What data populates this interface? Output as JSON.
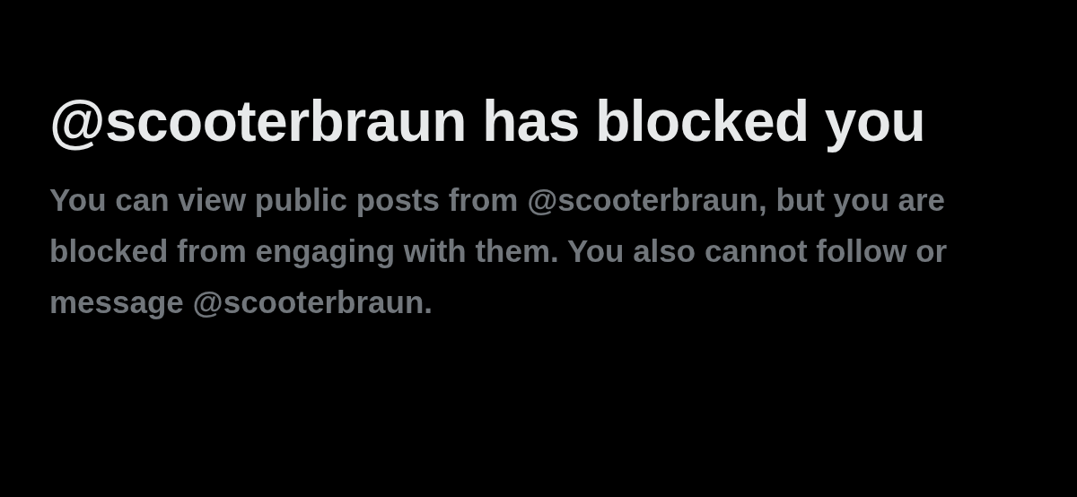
{
  "title": "@scooterbraun has blocked you",
  "message": "You can view public posts from @scooterbraun, but you are blocked from engaging with them. You also cannot follow or message @scooterbraun."
}
